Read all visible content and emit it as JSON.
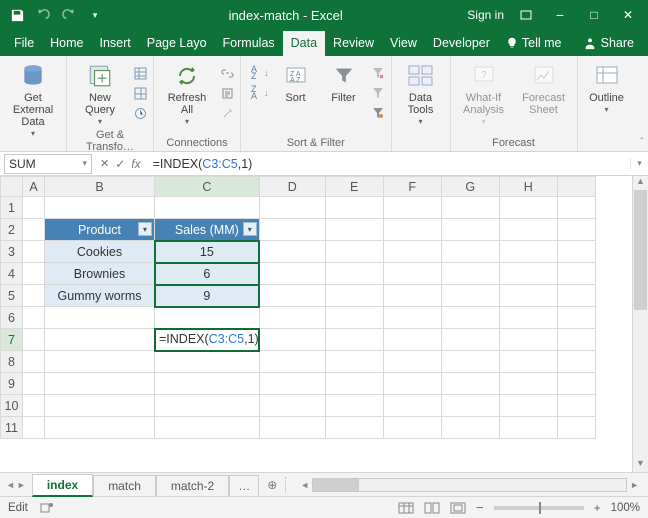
{
  "title": "index-match - Excel",
  "signin": "Sign in",
  "tabs": {
    "file": "File",
    "home": "Home",
    "insert": "Insert",
    "pagelayout": "Page Layo",
    "formulas": "Formulas",
    "data": "Data",
    "review": "Review",
    "view": "View",
    "developer": "Developer",
    "tellme": "Tell me",
    "share": "Share"
  },
  "ribbon": {
    "getexternal": "Get External\nData",
    "newquery": "New\nQuery",
    "gettransform": "Get & Transfo…",
    "refreshall": "Refresh\nAll",
    "connections": "Connections",
    "sort": "Sort",
    "filter": "Filter",
    "sortfilter": "Sort & Filter",
    "datatools": "Data\nTools",
    "whatif": "What-If\nAnalysis",
    "forecastsheet": "Forecast\nSheet",
    "forecast": "Forecast",
    "outline": "Outline"
  },
  "namebox": "SUM",
  "formula_plain": "=INDEX(C3:C5,1)",
  "formula_prefix": "=INDEX(",
  "formula_ref": "C3:C5",
  "formula_suffix": ",1)",
  "columns": [
    "A",
    "B",
    "C",
    "D",
    "E",
    "F",
    "G",
    "H"
  ],
  "rows": [
    "1",
    "2",
    "3",
    "4",
    "5",
    "6",
    "7",
    "8",
    "9",
    "10",
    "11"
  ],
  "table": {
    "h1": "Product",
    "h2": "Sales (MM)",
    "r": [
      [
        "Cookies",
        "15"
      ],
      [
        "Brownies",
        "6"
      ],
      [
        "Gummy worms",
        "9"
      ]
    ]
  },
  "sheets": {
    "s1": "index",
    "s2": "match",
    "s3": "match-2",
    "more": "…"
  },
  "status": {
    "mode": "Edit",
    "zoom": "100%"
  },
  "glyph": {
    "dropdown": "▾",
    "minus": "−",
    "plus": "+",
    "dots": "…",
    "x": "✕",
    "check": "✓",
    "fx": "fx",
    "left": "◄",
    "right": "►",
    "square": "□",
    "max": "▭"
  }
}
